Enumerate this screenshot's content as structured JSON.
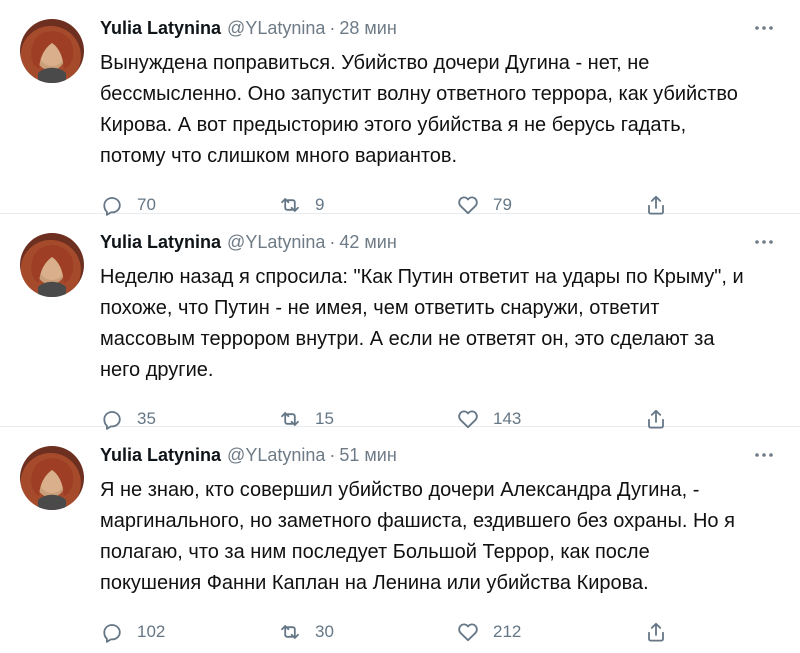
{
  "tweets": [
    {
      "author": "Yulia Latynina",
      "handle": "@YLatynina",
      "dot": "·",
      "time": "28 мин",
      "text": "Вынуждена поправиться. Убийство дочери Дугина - нет, не\nбессмысленно. Оно запустит волну ответного террора, как убийство\nКирова. А вот предысторию этого убийства я не берусь гадать,\nпотому что слишком много вариантов.",
      "replies": "70",
      "retweets": "9",
      "likes": "79"
    },
    {
      "author": "Yulia Latynina",
      "handle": "@YLatynina",
      "dot": "·",
      "time": "42 мин",
      "text": "Неделю назад я спросила: \"Как Путин ответит на удары по Крыму\", и\nпохоже, что Путин -  не имея, чем ответить снаружи, ответит\nмассовым террором внутри.  А если не ответят он, это сделают за\nнего другие.",
      "replies": "35",
      "retweets": "15",
      "likes": "143"
    },
    {
      "author": "Yulia Latynina",
      "handle": "@YLatynina",
      "dot": "·",
      "time": "51 мин",
      "text": "Я не знаю, кто совершил убийство дочери Александра Дугина, -\nмаргинального, но заметного фашиста, ездившего без охраны. Но я\nполагаю, что за ним последует Большой Террор, как после\nпокушения Фанни Каплан на Ленина или убийства Кирова.",
      "replies": "102",
      "retweets": "30",
      "likes": "212"
    }
  ],
  "icons": {
    "more": "more-horizontal-icon",
    "reply": "reply-icon",
    "retweet": "retweet-icon",
    "like": "heart-icon",
    "share": "share-icon"
  },
  "colors": {
    "text": "#0f1419",
    "secondary": "#6e7b86",
    "divider": "#e6ecf0"
  }
}
